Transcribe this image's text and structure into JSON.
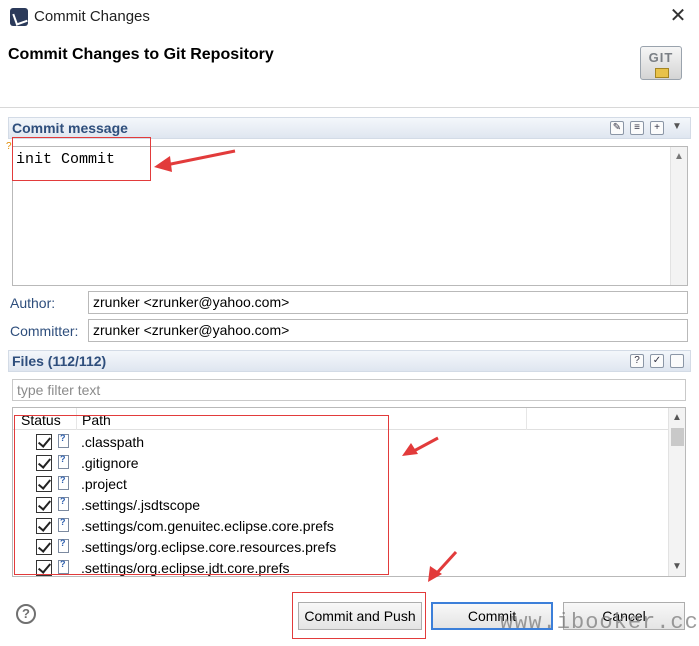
{
  "window": {
    "title": "Commit Changes",
    "close_label": "✕"
  },
  "banner": {
    "title": "Commit Changes to Git Repository",
    "logo_text": "GIT"
  },
  "commit_message": {
    "header": "Commit message",
    "text": "init Commit",
    "warning_mark": "?"
  },
  "author": {
    "label": "Author:",
    "value": "zrunker <zrunker@yahoo.com>"
  },
  "committer": {
    "label": "Committer:",
    "value": "zrunker <zrunker@yahoo.com>"
  },
  "files": {
    "header": "Files (112/112)",
    "filter_placeholder": "type filter text",
    "columns": {
      "status": "Status",
      "path": "Path"
    },
    "rows": [
      {
        "name": ".classpath"
      },
      {
        "name": ".gitignore"
      },
      {
        "name": ".project"
      },
      {
        "name": ".settings/.jsdtscope"
      },
      {
        "name": ".settings/com.genuitec.eclipse.core.prefs"
      },
      {
        "name": ".settings/org.eclipse.core.resources.prefs"
      },
      {
        "name": ".settings/org.eclipse.jdt.core.prefs"
      }
    ]
  },
  "buttons": {
    "help": "?",
    "commit_and_push": "Commit and Push",
    "commit": "Commit",
    "cancel": "Cancel"
  },
  "watermark": "www.ibooker.cc",
  "colors": {
    "annotation_red": "#e23b3b",
    "label_blue": "#2e4e7c",
    "default_button_border": "#3c7fd9"
  }
}
